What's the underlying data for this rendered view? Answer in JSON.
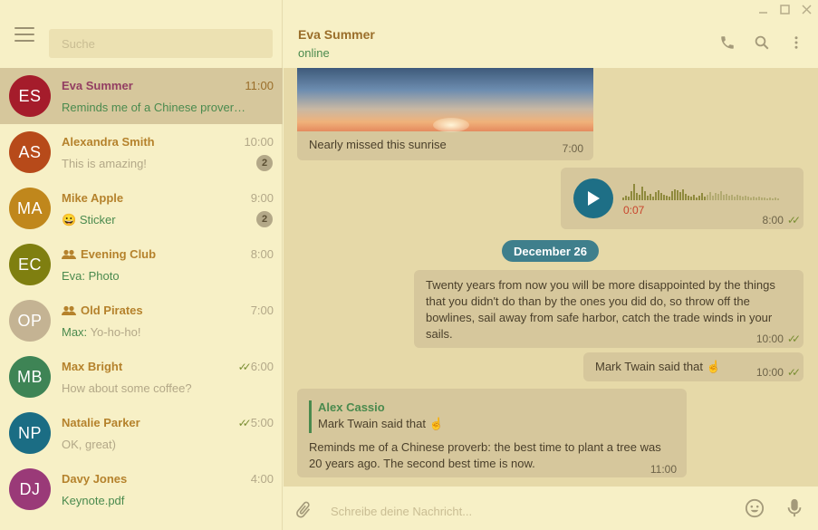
{
  "window": {
    "controls": [
      "minimize-icon",
      "maximize-icon",
      "close-icon"
    ]
  },
  "sidebar": {
    "search_placeholder": "Suche",
    "chats": [
      {
        "initials": "ES",
        "name": "Eva Summer",
        "time": "11:00",
        "message": "Reminds me of a Chinese proverb: the best time to plant a tree was 20 years ago. The second best time is now.",
        "color": "#a51c2b",
        "active": true
      },
      {
        "initials": "AS",
        "name": "Alexandra Smith",
        "time": "10:00",
        "message": "This is amazing!",
        "unread": "2",
        "color": "#b74a1a"
      },
      {
        "initials": "MA",
        "name": "Mike Apple",
        "time": "9:00",
        "message": "Sticker",
        "emoji": "😀",
        "unread": "2",
        "color": "#c0871c"
      },
      {
        "initials": "EC",
        "name": "Evening Club",
        "time": "8:00",
        "message": "Photo",
        "sender": "Eva:",
        "group": true,
        "color": "#7f7f10"
      },
      {
        "initials": "OP",
        "name": "Old Pirates",
        "time": "7:00",
        "message": "Yo-ho-ho!",
        "sender": "Max:",
        "group": true,
        "color": "#c4b393"
      },
      {
        "initials": "MB",
        "name": "Max Bright",
        "time": "6:00",
        "message": "How about some coffee?",
        "read": true,
        "color": "#3e8455"
      },
      {
        "initials": "NP",
        "name": "Natalie Parker",
        "time": "5:00",
        "message": "OK, great)",
        "read": true,
        "color": "#1b6d84"
      },
      {
        "initials": "DJ",
        "name": "Davy Jones",
        "time": "4:00",
        "message": "Keynote.pdf",
        "color": "#9a3a78"
      }
    ]
  },
  "header": {
    "name": "Eva Summer",
    "status": "online",
    "icons": [
      "phone-icon",
      "search-icon",
      "more-icon"
    ]
  },
  "messages": {
    "photo_caption": "Nearly missed this sunrise",
    "photo_time": "7:00",
    "voice_duration": "0:07",
    "voice_time": "8:00",
    "date_separator": "December 26",
    "quote_text": "Twenty years from now you will be more disappointed by the things that you didn't do than by the ones you did do, so throw off the bowlines, sail away from safe harbor, catch the trade winds in your sails.",
    "quote_time": "10:00",
    "twain_text": "Mark Twain said that ☝️",
    "twain_time": "10:00",
    "reply_author": "Alex Cassio",
    "reply_quoted": "Mark Twain said that ☝️",
    "reply_text": "Reminds me of a Chinese proverb: the best time to plant a tree was 20 years ago. The second best time is now.",
    "reply_time": "11:00"
  },
  "composer": {
    "placeholder": "Schreibe deine Nachricht..."
  },
  "theme": {
    "sidebar_bg": "#f7f0c6",
    "chat_bg": "#e6d9a8",
    "bubble_bg": "#d6c79c",
    "accent": "#3f7f8c",
    "play_button": "#1e6f86"
  }
}
